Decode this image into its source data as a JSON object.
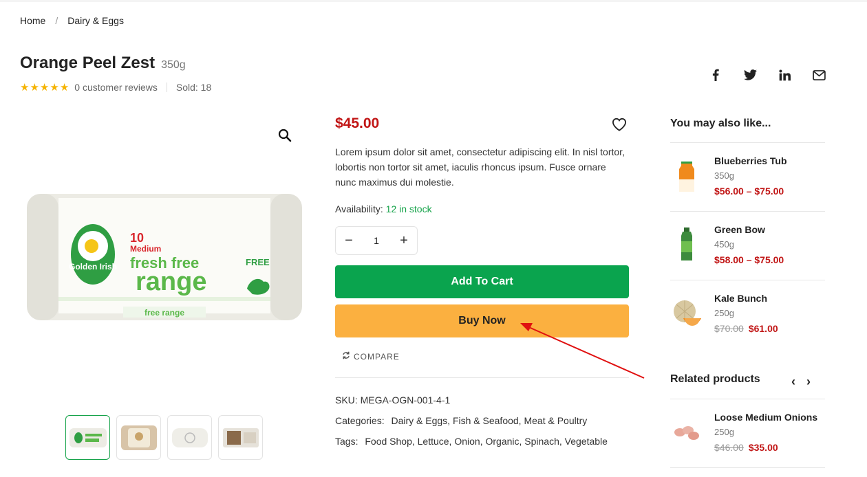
{
  "breadcrumb": {
    "home": "Home",
    "separator": "/",
    "current": "Dairy & Eggs"
  },
  "product": {
    "title": "Orange Peel Zest",
    "weight": "350g",
    "rating_stars": 5,
    "reviews": "0 customer reviews",
    "sold": "Sold: 18",
    "price": "$45.00",
    "description": "Lorem ipsum dolor sit amet, consectetur adipiscing elit. In nisl tortor, lobortis non tortor sit amet, iaculis rhoncus ipsum. Fusce ornare nunc maximus dui molestie.",
    "availability_label": "Availability:",
    "availability_value": "12 in stock",
    "quantity": "1",
    "add_to_cart": "Add To Cart",
    "buy_now": "Buy Now",
    "compare": "COMPARE",
    "sku_label": "SKU:",
    "sku": "MEGA-OGN-001-4-1",
    "categories_label": "Categories:",
    "categories": "Dairy & Eggs, Fish & Seafood, Meat & Poultry",
    "tags_label": "Tags:",
    "tags": "Food Shop, Lettuce, Onion, Organic, Spinach, Vegetable",
    "image_text": {
      "brand": "Golden Irish",
      "count": "10",
      "size": "Medium",
      "headline_top": "fresh free",
      "headline_bottom": "range",
      "badge": "FREE",
      "strip": "free range"
    }
  },
  "share_icons": [
    "facebook-icon",
    "twitter-icon",
    "linkedin-icon",
    "mail-icon"
  ],
  "sidebar": {
    "also_like_title": "You may also like...",
    "also_like": [
      {
        "name": "Blueberries Tub",
        "weight": "350g",
        "price": "$56.00 – $75.00",
        "old_price": ""
      },
      {
        "name": "Green Bow",
        "weight": "450g",
        "price": "$58.00 – $75.00",
        "old_price": ""
      },
      {
        "name": "Kale Bunch",
        "weight": "250g",
        "price": "$61.00",
        "old_price": "$70.00"
      }
    ],
    "related_title": "Related products",
    "related": [
      {
        "name": "Loose Medium Onions",
        "weight": "250g",
        "price": "$35.00",
        "old_price": "$46.00"
      }
    ]
  },
  "colors": {
    "price": "#c11515",
    "stock": "#16a34a",
    "add_to_cart": "#0aa44e",
    "buy_now": "#fbb040",
    "annotation_arrow": "#e01010"
  }
}
